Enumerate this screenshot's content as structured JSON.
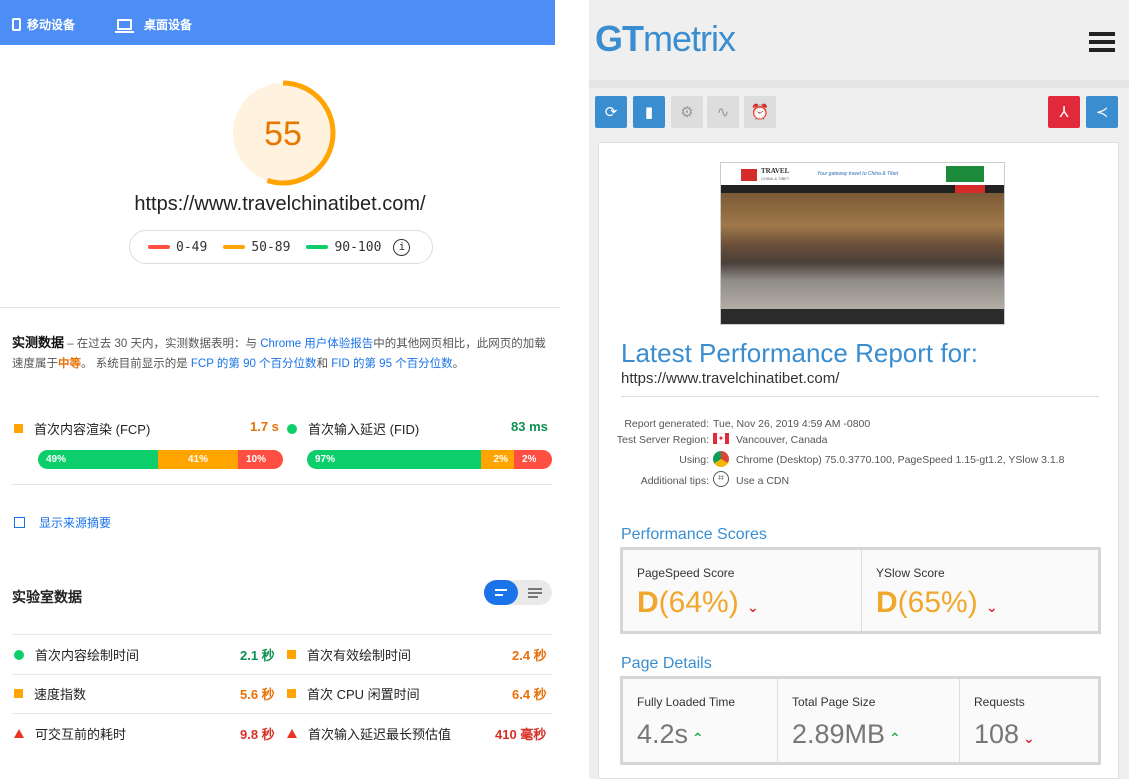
{
  "left": {
    "tabs": {
      "mobile": "移动设备",
      "desktop": "桌面设备"
    },
    "score": "55",
    "url": "https://www.travelchinatibet.com/",
    "legend": {
      "red": "0-49",
      "orange": "50-89",
      "green": "90-100",
      "info": "i"
    },
    "field": {
      "heading": "实测数据",
      "desc1": " – 在过去 30 天内，实测数据表明：与 ",
      "report": "Chrome 用户体验报告",
      "desc2": "中的其他网页相比，此网页的加载速度属于",
      "speed": "中等",
      "desc3": "。 系统目前显示的是 ",
      "fcp_pct": "FCP 的第 90 个百分位数",
      "desc4": "和 ",
      "fid_pct": "FID 的第 95 个百分位数",
      "desc5": "。"
    },
    "fcp": {
      "label": "首次内容渲染 (FCP)",
      "value": "1.7 s",
      "dist": [
        "49%",
        "41%",
        "10%"
      ]
    },
    "fid": {
      "label": "首次输入延迟 (FID)",
      "value": "83 ms",
      "dist": [
        "97%",
        "2%",
        "2%"
      ]
    },
    "show_origin": "显示来源摘要",
    "lab_title": "实验室数据",
    "lab": [
      {
        "label": "首次内容绘制时间",
        "value": "2.1 秒"
      },
      {
        "label": "首次有效绘制时间",
        "value": "2.4 秒"
      },
      {
        "label": "速度指数",
        "value": "5.6 秒"
      },
      {
        "label": "首次 CPU 闲置时间",
        "value": "6.4 秒"
      },
      {
        "label": "可交互前的耗时",
        "value": "9.8 秒"
      },
      {
        "label": "首次输入延迟最长预估值",
        "value": "410 毫秒"
      }
    ],
    "colors": {
      "blue": "#4c8df6",
      "green": "#0cce6b",
      "orange": "#ffa400",
      "red": "#ff4e42"
    }
  },
  "right": {
    "logo_gt": "GT",
    "logo_metrix": "metrix",
    "thumb": {
      "brand": "TRAVEL",
      "brand_sub": "CHINA & TIBET",
      "tagline": "Your gateway travel to China & Tibet"
    },
    "title": "Latest Performance Report for:",
    "url": "https://www.travelchinatibet.com/",
    "info": [
      {
        "label": "Report generated:",
        "value": "Tue, Nov 26, 2019 4:59 AM -0800"
      },
      {
        "label": "Test Server Region:",
        "value": "Vancouver, Canada"
      },
      {
        "label": "Using:",
        "value": "Chrome (Desktop) 75.0.3770.100, PageSpeed 1.15-gt1.2, YSlow 3.1.8"
      },
      {
        "label": "Additional tips:",
        "value": "Use a CDN"
      }
    ],
    "perf_title": "Performance Scores",
    "pagespeed": {
      "label": "PageSpeed Score",
      "grade": "D",
      "pct": "(64%)"
    },
    "yslow": {
      "label": "YSlow Score",
      "grade": "D",
      "pct": "(65%)"
    },
    "details_title": "Page Details",
    "details": [
      {
        "label": "Fully Loaded Time",
        "value": "4.2s"
      },
      {
        "label": "Total Page Size",
        "value": "2.89MB"
      },
      {
        "label": "Requests",
        "value": "108"
      }
    ],
    "colors": {
      "brand": "#3a8ed0",
      "grade": "#f0a72c",
      "toolbar_blue": "#3a8ed0",
      "pdf_red": "#e0293b"
    }
  }
}
